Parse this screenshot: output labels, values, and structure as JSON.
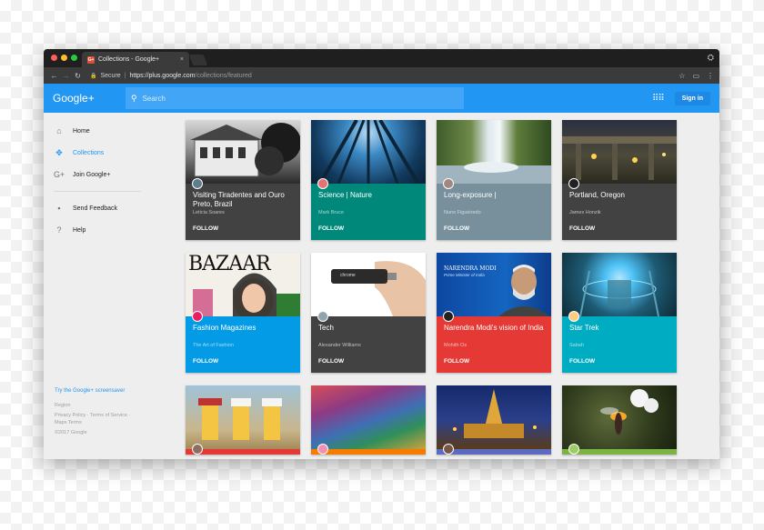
{
  "browser": {
    "tab_title": "Collections - Google+",
    "tab_close": "×",
    "tab_favicon": "G+",
    "secure_label": "Secure",
    "url_host": "https://plus.google.com",
    "url_path": "/collections/featured"
  },
  "header": {
    "logo": "Google+",
    "search_placeholder": "Search",
    "sign_in": "Sign in"
  },
  "sidebar": {
    "items": [
      {
        "label": "Home",
        "icon": "home-icon"
      },
      {
        "label": "Collections",
        "icon": "collections-icon"
      },
      {
        "label": "Join Google+",
        "icon": "gplus-icon"
      },
      {
        "label": "Send Feedback",
        "icon": "feedback-icon"
      },
      {
        "label": "Help",
        "icon": "help-icon"
      }
    ],
    "footer": {
      "screensaver": "Try the Google+ screensaver",
      "region": "Region",
      "policy_line1": "Privacy Policy · Terms of Service ·",
      "policy_line2": "Maps Terms",
      "copyright": "©2017 Google"
    }
  },
  "cards": [
    {
      "title": "Visiting Tiradentes and Ouro Preto, Brazil",
      "author": "Leticia Soares",
      "follow": "FOLLOW",
      "color": "#424242"
    },
    {
      "title": "Science | Nature",
      "author": "Mark Bruce",
      "follow": "FOLLOW",
      "color": "#00897b"
    },
    {
      "title": "Long-exposure |",
      "author": "Nuno Figueiredo",
      "follow": "FOLLOW",
      "color": "#78909c"
    },
    {
      "title": "Portland, Oregon",
      "author": "James Honzik",
      "follow": "FOLLOW",
      "color": "#424242"
    },
    {
      "title": "Fashion Magazines",
      "author": "The Art of Fashion",
      "follow": "FOLLOW",
      "color": "#039be5"
    },
    {
      "title": "Tech",
      "author": "Alexander Williams",
      "follow": "FOLLOW",
      "color": "#424242"
    },
    {
      "title": "Narendra Modi's vision of India",
      "author": "Mohith Os",
      "follow": "FOLLOW",
      "color": "#e53935"
    },
    {
      "title": "Star Trek",
      "author": "Sabah",
      "follow": "FOLLOW",
      "color": "#00acc1"
    },
    {
      "color": "#e53935"
    },
    {
      "color": "#f57c00"
    },
    {
      "color": "#5c6bc0"
    },
    {
      "color": "#7cb342"
    }
  ],
  "image_texts": {
    "bazaar": "BAZAAR",
    "modi_name": "NARENDRA MODI",
    "modi_role": "Prime Minister of India",
    "chrome": "chrome"
  }
}
